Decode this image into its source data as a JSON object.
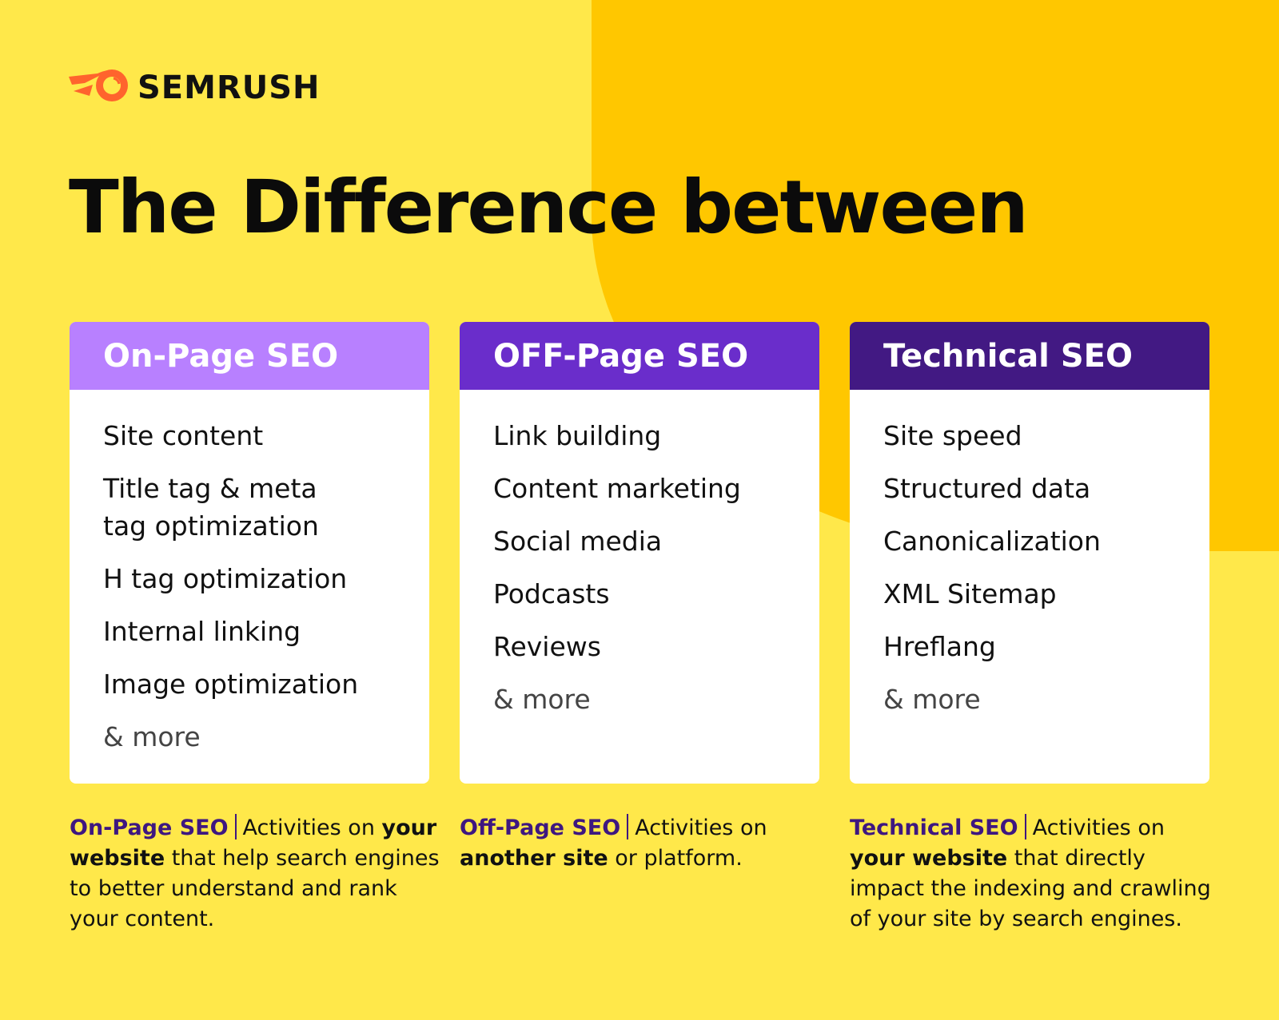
{
  "brand": {
    "logo_icon": "semrush-comet-icon",
    "name": "SEMRUSH",
    "icon_color": "#FF642D"
  },
  "title": "The Difference between",
  "colors": {
    "background": "#FFE84A",
    "background_accent": "#FFC700",
    "on_page": "#B880FF",
    "off_page": "#6A2DCB",
    "technical": "#421983",
    "note_label": "#3E1780"
  },
  "cards": [
    {
      "title": "On-Page SEO",
      "items": [
        "Site content",
        "Title tag & meta tag optimization",
        "H tag optimization",
        "Internal linking",
        "Image optimization",
        "& more"
      ]
    },
    {
      "title": "OFF-Page SEO",
      "items": [
        "Link building",
        "Content marketing",
        "Social media",
        "Podcasts",
        "Reviews",
        "& more"
      ]
    },
    {
      "title": "Technical SEO",
      "items": [
        "Site speed",
        "Structured data",
        "Canonicalization",
        "XML Sitemap",
        "Hreflang",
        "& more"
      ]
    }
  ],
  "notes": [
    {
      "label": "On-Page SEO",
      "t1": "Activities on ",
      "b1": "your website",
      "t2": " that help search engines to better understand and rank your content."
    },
    {
      "label": "Off-Page SEO",
      "t1": "Activities on ",
      "b1": "another site",
      "t2": " or platform."
    },
    {
      "label": "Technical SEO",
      "t1": "Activities on ",
      "b1": "your website",
      "t2": " that directly impact the indexing and crawling of your site by search engines."
    }
  ]
}
